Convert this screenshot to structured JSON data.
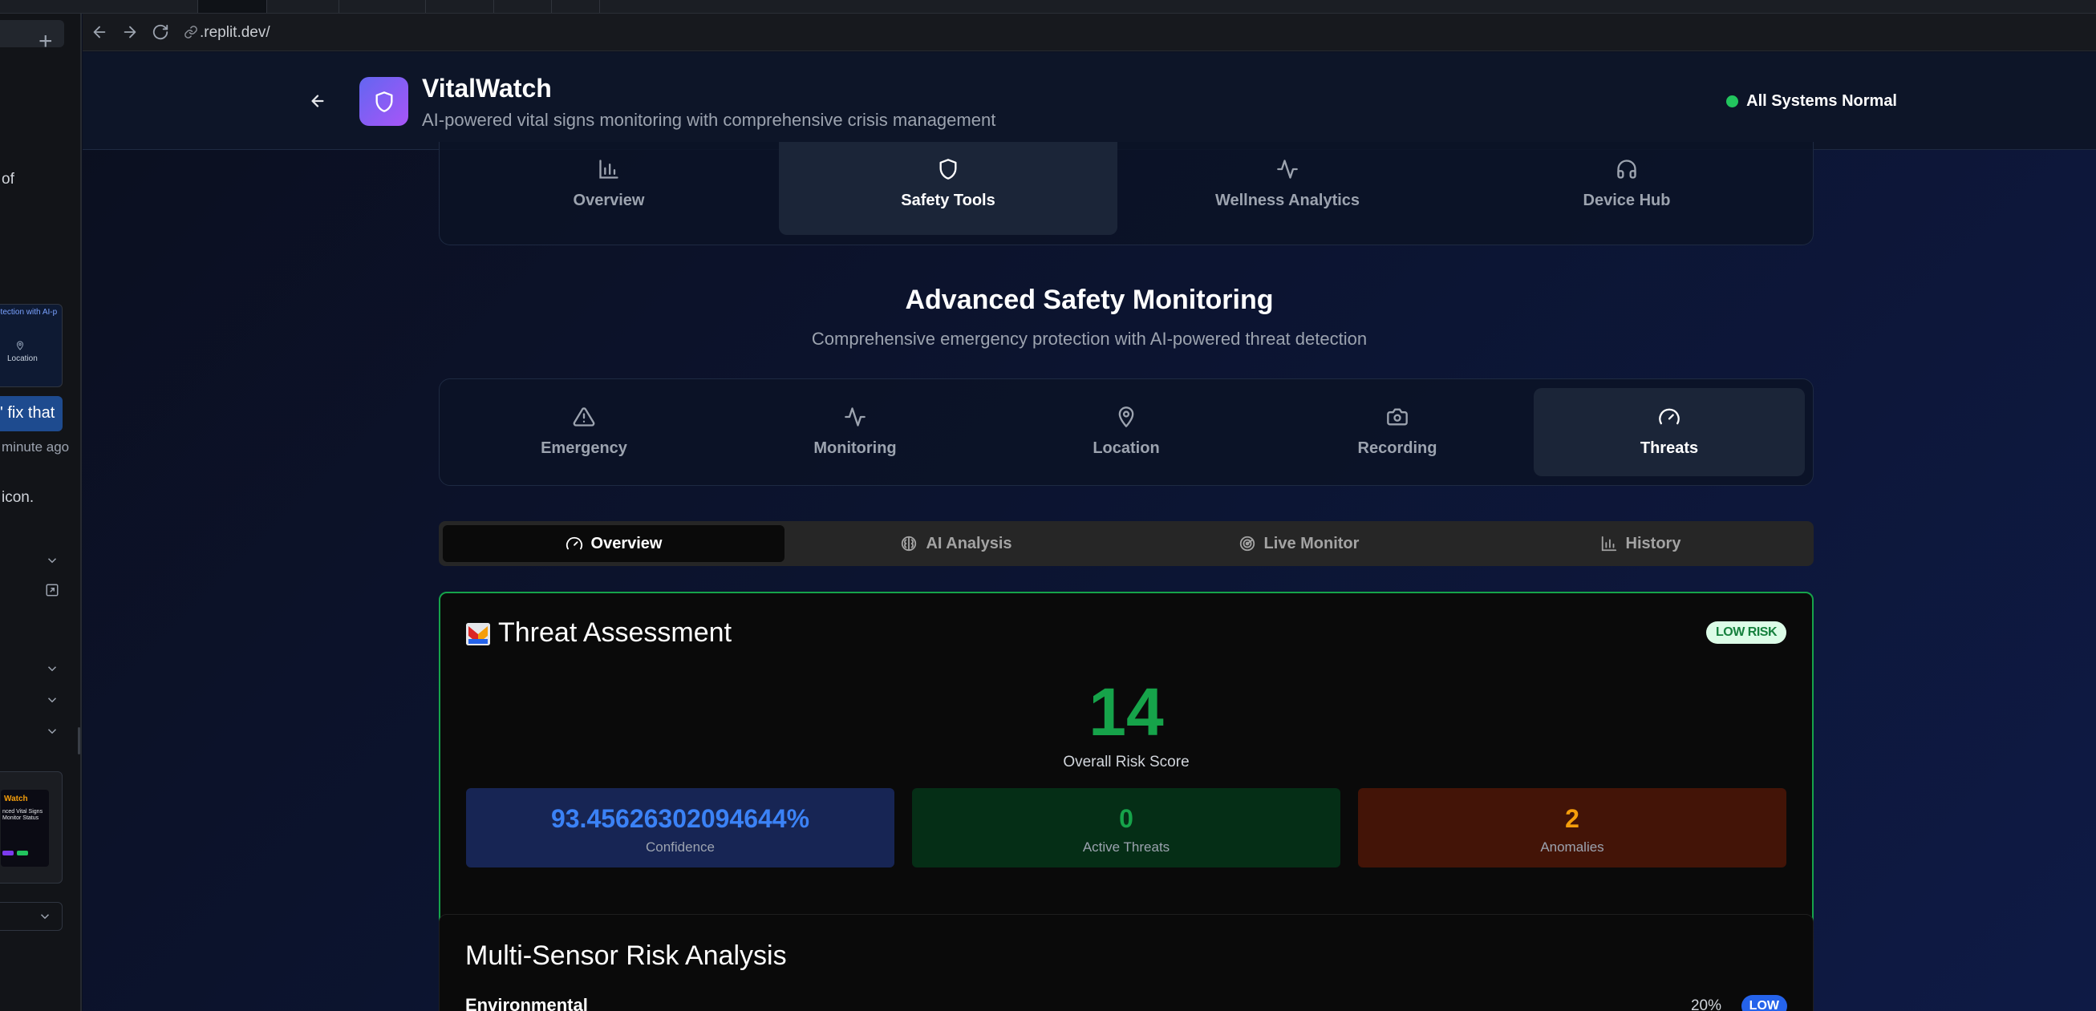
{
  "browser": {
    "url": ".replit.dev/"
  },
  "sidepanel": {
    "snippets": {
      "of": "of",
      "thumb_caption": "otection with AI-p",
      "thumb_location": "Location",
      "fix_that": "' fix that",
      "minute_ago": "minute ago",
      "icon": "icon.",
      "thumb_brand": "Watch",
      "thumb_text": "nced Vital Signs Monitor Status"
    }
  },
  "header": {
    "title": "VitalWatch",
    "subtitle": "AI-powered vital signs monitoring with comprehensive crisis management",
    "status": "All Systems Normal"
  },
  "main_tabs": [
    {
      "label": "Overview",
      "icon": "bar-chart-icon"
    },
    {
      "label": "Safety Tools",
      "icon": "shield-icon"
    },
    {
      "label": "Wellness Analytics",
      "icon": "activity-icon"
    },
    {
      "label": "Device Hub",
      "icon": "headphones-icon"
    }
  ],
  "section": {
    "title": "Advanced Safety Monitoring",
    "subtitle": "Comprehensive emergency protection with AI-powered threat detection"
  },
  "safety_tabs": [
    {
      "label": "Emergency",
      "icon": "alert-triangle-icon"
    },
    {
      "label": "Monitoring",
      "icon": "activity-icon"
    },
    {
      "label": "Location",
      "icon": "map-pin-icon"
    },
    {
      "label": "Recording",
      "icon": "camera-icon"
    },
    {
      "label": "Threats",
      "icon": "gauge-icon"
    }
  ],
  "threat_tabs": [
    {
      "label": "Overview",
      "icon": "gauge-icon"
    },
    {
      "label": "AI Analysis",
      "icon": "brain-icon"
    },
    {
      "label": "Live Monitor",
      "icon": "radar-icon"
    },
    {
      "label": "History",
      "icon": "bar-chart-icon"
    }
  ],
  "assessment": {
    "title": "Threat Assessment",
    "risk_level": "LOW RISK",
    "score": "14",
    "score_label": "Overall Risk Score",
    "confidence_value": "93.45626302094644%",
    "confidence_label": "Confidence",
    "active_threats_value": "0",
    "active_threats_label": "Active Threats",
    "anomalies_value": "2",
    "anomalies_label": "Anomalies"
  },
  "multi_sensor": {
    "title": "Multi-Sensor Risk Analysis",
    "row_label": "Environmental",
    "row_percent": "20%",
    "row_level": "LOW"
  },
  "colors": {
    "accent_green": "#16a34a",
    "status_green": "#22c55e",
    "confidence_blue": "#3b82f6",
    "anomaly_amber": "#f59e0b",
    "logo_gradient_start": "#6366f1",
    "logo_gradient_end": "#a855f7"
  }
}
